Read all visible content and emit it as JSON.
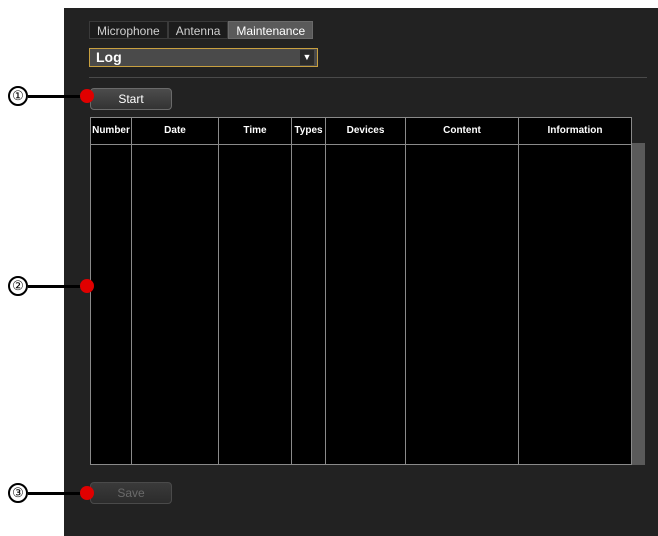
{
  "tabs": [
    {
      "label": "Microphone",
      "active": false
    },
    {
      "label": "Antenna",
      "active": false
    },
    {
      "label": "Maintenance",
      "active": true
    }
  ],
  "dropdown": {
    "value": "Log",
    "icon": "triangle-down-icon"
  },
  "buttons": {
    "start": "Start",
    "save": "Save"
  },
  "table": {
    "columns": [
      "Number",
      "Date",
      "Time",
      "Types",
      "Devices",
      "Content",
      "Information"
    ],
    "rows": []
  },
  "callouts": [
    "①",
    "②",
    "③"
  ],
  "colors": {
    "panel_bg": "#222222",
    "table_bg": "#000000",
    "callout_dot": "#e00000",
    "dropdown_border": "#c8a040"
  }
}
